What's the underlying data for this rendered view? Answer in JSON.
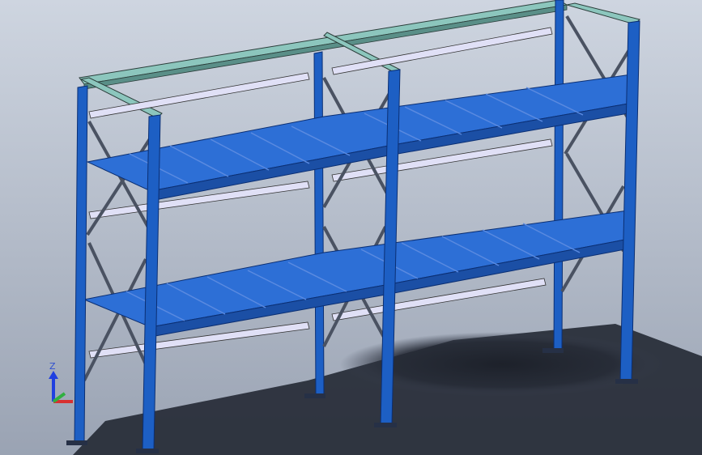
{
  "viewport": {
    "background_top": "#ced5e0",
    "background_bottom": "#9aa3b3",
    "model": "storage-rack-assembly"
  },
  "colors": {
    "frame_blue": "#1d5fc4",
    "frame_dark": "#0b2f73",
    "shelf_top": "#2d6fd6",
    "shelf_dark": "#1b4fa5",
    "beam_teal": "#7fb8b0",
    "bar_lavender": "#e0e0f6",
    "shadow": "#262b36"
  },
  "triad": {
    "z_label": "Z",
    "x_color": "#d83030",
    "y_color": "#30b040",
    "z_color": "#2040e0"
  }
}
